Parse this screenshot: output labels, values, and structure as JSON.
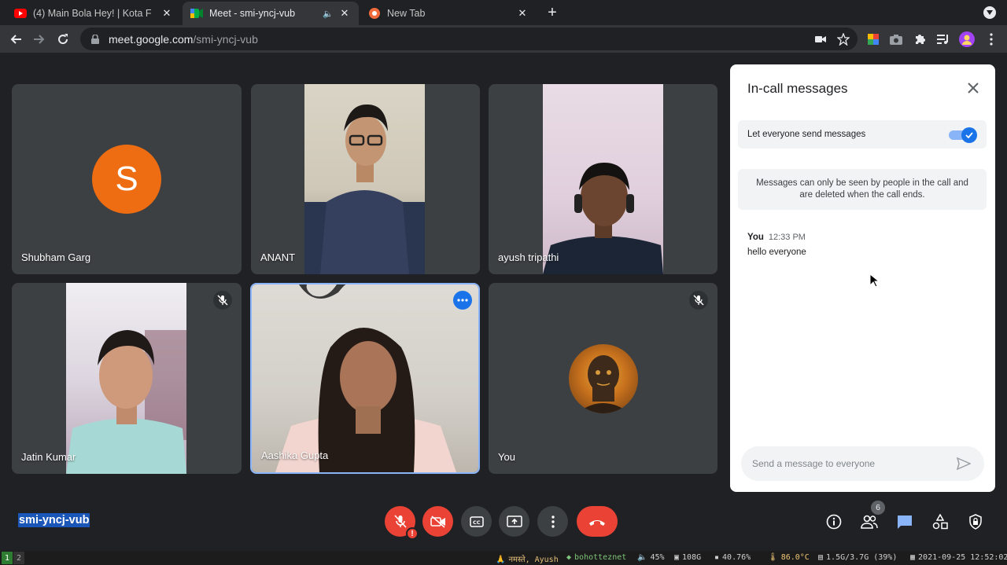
{
  "browser": {
    "tabs": [
      {
        "title": "(4) Main Bola Hey! | Kota F",
        "icon": "youtube-icon",
        "active": false
      },
      {
        "title": "Meet - smi-yncj-vub",
        "icon": "meet-icon",
        "active": true
      },
      {
        "title": "New Tab",
        "icon": "brave-icon",
        "active": false
      }
    ],
    "url_domain": "meet.google.com",
    "url_path": "/smi-yncj-vub"
  },
  "participants": [
    {
      "name": "Shubham Garg",
      "initial": "S",
      "avatar_color": "#ee6d12"
    },
    {
      "name": "ANANT"
    },
    {
      "name": "ayush tripathi"
    },
    {
      "name": "Jatin Kumar",
      "muted": true
    },
    {
      "name": "Aashika Gupta",
      "highlighted": true
    },
    {
      "name": "You",
      "muted": true
    }
  ],
  "chat": {
    "title": "In-call messages",
    "toggle_label": "Let everyone send messages",
    "toggle_on": true,
    "info": "Messages can only be seen by people in the call and are deleted when the call ends.",
    "messages": [
      {
        "sender": "You",
        "time": "12:33 PM",
        "text": "hello everyone"
      }
    ],
    "composer_placeholder": "Send a message to everyone"
  },
  "meeting": {
    "code": "smi-yncj-vub",
    "people_count": "6"
  },
  "colors": {
    "accent": "#1a73e8",
    "danger": "#ea4335",
    "background": "#202124"
  },
  "statusbar": {
    "workspaces": [
      "1",
      "2"
    ],
    "greeting": "नमस्ते, Ayush",
    "network": "bohotteznet",
    "volume": "45%",
    "disk": "108G",
    "cpu": "40.76%",
    "temp": "86.0°C",
    "memory": "1.5G/3.7G (39%)",
    "datetime": "2021-09-25 12:52:02"
  }
}
